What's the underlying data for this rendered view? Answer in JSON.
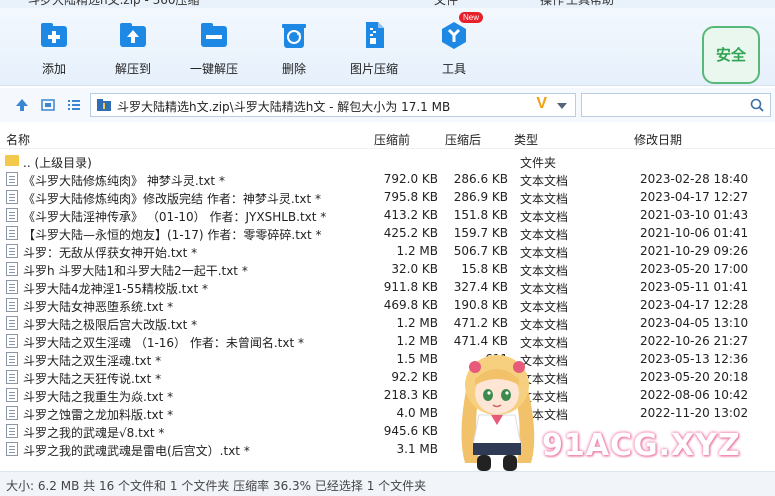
{
  "window": {
    "title": "斗罗大陆精选h文.zip - 360压缩",
    "menu": [
      "文件",
      "操作",
      "工具",
      "帮助"
    ]
  },
  "toolbar": {
    "buttons": [
      {
        "label": "添加",
        "icon": "add-icon"
      },
      {
        "label": "解压到",
        "icon": "extract-to-icon"
      },
      {
        "label": "一键解压",
        "icon": "one-click-extract-icon"
      },
      {
        "label": "删除",
        "icon": "recycle-icon"
      },
      {
        "label": "图片压缩",
        "icon": "image-compress-icon"
      },
      {
        "label": "工具",
        "icon": "tools-icon",
        "badge": "New"
      }
    ],
    "safe_label": "安全"
  },
  "address": {
    "path": "斗罗大陆精选h文.zip\\斗罗大陆精选h文 - 解包大小为 17.1 MB",
    "vip_mark": "V",
    "search_placeholder": ""
  },
  "columns": {
    "name": "名称",
    "size": "压缩前",
    "packed": "压缩后",
    "type": "类型",
    "date": "修改日期"
  },
  "rows": [
    {
      "name": ".. (上级目录)",
      "size": "",
      "packed": "",
      "type": "文件夹",
      "date": "",
      "is_folder": true
    },
    {
      "name": "《斗罗大陆修炼纯肉》 神梦斗灵.txt *",
      "size": "792.0 KB",
      "packed": "286.6 KB",
      "type": "文本文档",
      "date": "2023-02-28 18:40"
    },
    {
      "name": "《斗罗大陆修炼纯肉》修改版完结 作者：神梦斗灵.txt *",
      "size": "795.8 KB",
      "packed": "286.9 KB",
      "type": "文本文档",
      "date": "2023-04-17 12:27"
    },
    {
      "name": "《斗罗大陆淫神传承》 （01-10） 作者：JYXSHLB.txt *",
      "size": "413.2 KB",
      "packed": "151.8 KB",
      "type": "文本文档",
      "date": "2021-03-10 01:43"
    },
    {
      "name": "【斗罗大陆—永恒的炮友】(1-17) 作者：零零碎碎.txt *",
      "size": "425.2 KB",
      "packed": "159.7 KB",
      "type": "文本文档",
      "date": "2021-10-06 01:41"
    },
    {
      "name": "斗罗：无敌从俘获女神开始.txt *",
      "size": "1.2 MB",
      "packed": "506.7 KB",
      "type": "文本文档",
      "date": "2021-10-29 09:26"
    },
    {
      "name": "斗罗h 斗罗大陆1和斗罗大陆2一起干.txt *",
      "size": "32.0 KB",
      "packed": "15.8 KB",
      "type": "文本文档",
      "date": "2023-05-20 17:00"
    },
    {
      "name": "斗罗大陆4龙神淫1-55精校版.txt *",
      "size": "911.8 KB",
      "packed": "327.4 KB",
      "type": "文本文档",
      "date": "2023-05-11 01:41"
    },
    {
      "name": "斗罗大陆女神恶堕系统.txt *",
      "size": "469.8 KB",
      "packed": "190.8 KB",
      "type": "文本文档",
      "date": "2023-04-17 12:28"
    },
    {
      "name": "斗罗大陆之极限后宫大改版.txt *",
      "size": "1.2 MB",
      "packed": "471.2 KB",
      "type": "文本文档",
      "date": "2023-04-05 13:10"
    },
    {
      "name": "斗罗大陆之双生淫魂 （1-16） 作者：未曾闻名.txt *",
      "size": "1.2 MB",
      "packed": "471.4 KB",
      "type": "文本文档",
      "date": "2022-10-26 21:27"
    },
    {
      "name": "斗罗大陆之双生淫魂.txt *",
      "size": "1.5 MB",
      "packed": "611",
      "type": "文本文档",
      "date": "2023-05-13 12:36"
    },
    {
      "name": "斗罗大陆之天狂传说.txt *",
      "size": "92.2 KB",
      "packed": "",
      "type": "文本文档",
      "date": "2023-05-20 20:18"
    },
    {
      "name": "斗罗大陆之我重生为焱.txt *",
      "size": "218.3 KB",
      "packed": "",
      "type": "文本文档",
      "date": "2022-08-06 10:42"
    },
    {
      "name": "斗罗之蚀雷之龙加料版.txt *",
      "size": "4.0 MB",
      "packed": "",
      "type": "文本文档",
      "date": "2022-11-20 13:02"
    },
    {
      "name": "斗罗之我的武魂是√8.txt *",
      "size": "945.6 KB",
      "packed": "",
      "type": "",
      "date": ""
    },
    {
      "name": "斗罗之我的武魂武魂是雷电(后宫文）.txt *",
      "size": "3.1 MB",
      "packed": "",
      "type": "",
      "date": ""
    }
  ],
  "watermark": "91ACG.XYZ",
  "status": "大小: 6.2 MB 共 16 个文件和 1 个文件夹 压缩率 36.3% 已经选择 1 个文件夹",
  "colors": {
    "toolbar_icon_blue": "#1e88e5",
    "safe_green": "#32a455",
    "folder_yellow": "#f4c84a",
    "vip_orange": "#f0a010"
  }
}
